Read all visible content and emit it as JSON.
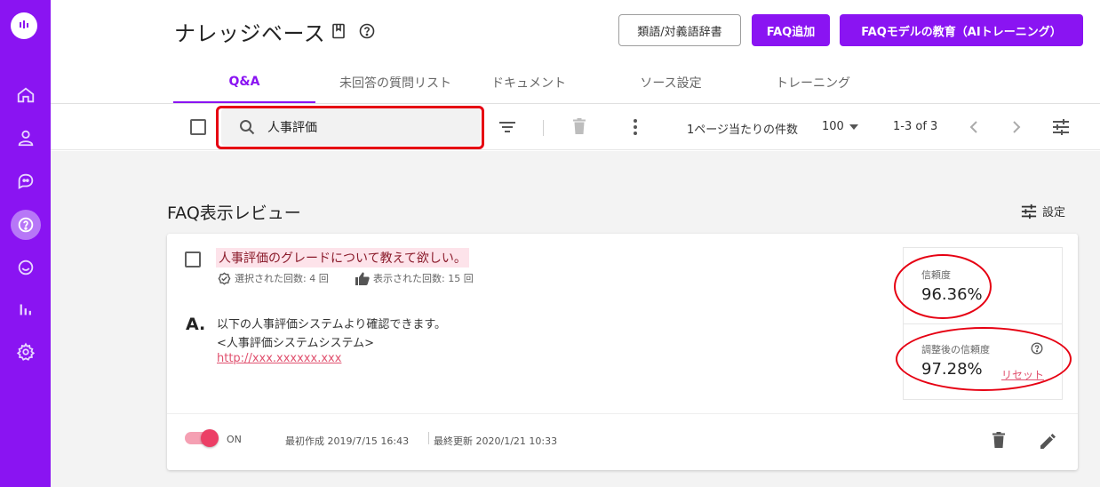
{
  "header": {
    "title": "ナレッジベース",
    "buttons": {
      "synonym": "類語/対義語辞書",
      "add_faq": "FAQ追加",
      "train": "FAQモデルの教育（AIトレーニング）"
    }
  },
  "tabs": [
    {
      "label": "Q&A",
      "active": true
    },
    {
      "label": "未回答の質問リスト",
      "active": false
    },
    {
      "label": "ドキュメント",
      "active": false
    },
    {
      "label": "ソース設定",
      "active": false
    },
    {
      "label": "トレーニング",
      "active": false
    }
  ],
  "toolbar": {
    "search_value": "人事評価",
    "per_page_label": "1ページ当たりの件数",
    "per_page_value": "100",
    "range": "1-3 of 3"
  },
  "section": {
    "title": "FAQ表示レビュー",
    "settings_label": "設定"
  },
  "card": {
    "question": "人事評価のグレードについて教えて欲しい。",
    "selected_count": "選択された回数: 4 回",
    "displayed_count": "表示された回数: 15 回",
    "answer_label": "A.",
    "answer_lines": [
      "以下の人事評価システムより確認できます。",
      "<人事評価システムシステム>"
    ],
    "answer_link": "http://xxx.xxxxxx.xxx",
    "confidence_label": "信頼度",
    "confidence_value": "96.36%",
    "adjusted_label": "調整後の信頼度",
    "adjusted_value": "97.28%",
    "reset_label": "リセット",
    "toggle_label": "ON",
    "created": "最初作成 2019/7/15 16:43",
    "updated": "最終更新 2020/1/21 10:33"
  },
  "colors": {
    "brand": "#8a14f2",
    "highlight": "#e60012",
    "accent_pink": "#ec3f66"
  },
  "icons": [
    "logo-icon",
    "home-icon",
    "user-icon",
    "chat-icon",
    "faq-icon",
    "conversation-icon",
    "analytics-icon",
    "gear-icon",
    "book-icon",
    "help-icon",
    "search-icon",
    "filter-icon",
    "trash-icon",
    "more-icon",
    "chevron-left-icon",
    "chevron-right-icon",
    "tune-icon",
    "check-circle-icon",
    "thumb-up-icon",
    "edit-icon"
  ]
}
